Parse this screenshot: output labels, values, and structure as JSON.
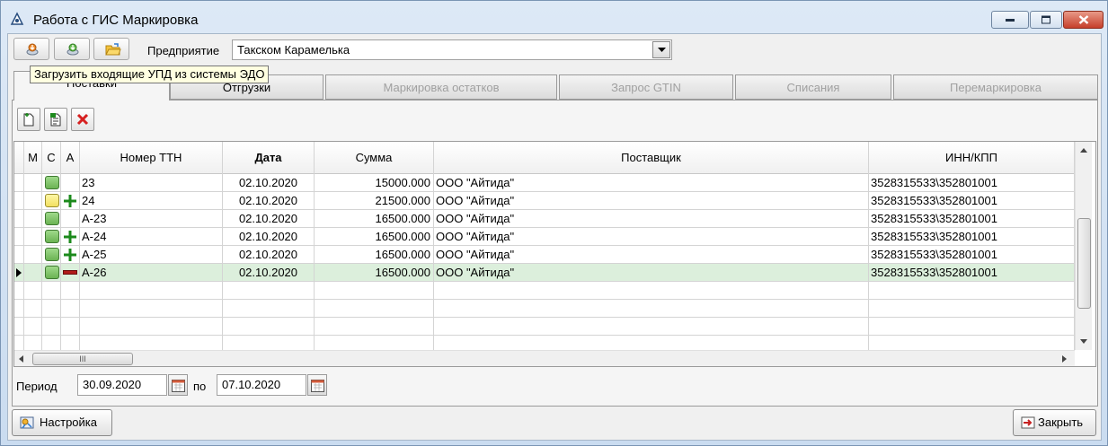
{
  "window": {
    "title": "Работа с ГИС Маркировка"
  },
  "toolbar": {
    "enterprise_label": "Предприятие",
    "enterprise_value": "Такском Карамелька",
    "tooltip": "Загрузить входящие УПД из системы ЭДО"
  },
  "tabs": [
    {
      "label": "Поставки",
      "state": "active"
    },
    {
      "label": "Отгрузки",
      "state": "enabled"
    },
    {
      "label": "Маркировка остатков",
      "state": "disabled"
    },
    {
      "label": "Запрос GTIN",
      "state": "disabled"
    },
    {
      "label": "Списания",
      "state": "disabled"
    },
    {
      "label": "Перемаркировка",
      "state": "disabled"
    }
  ],
  "grid": {
    "columns": [
      "М",
      "С",
      "А",
      "Номер ТТН",
      "Дата",
      "Сумма",
      "Поставщик",
      "ИНН/КПП"
    ],
    "rows": [
      {
        "status": "green",
        "action": "",
        "number": "23",
        "date": "02.10.2020",
        "sum": "15000.000",
        "supplier": "ООО \"Айтида\"",
        "inn": "3528315533\\352801001"
      },
      {
        "status": "yellow",
        "action": "plus",
        "number": "24",
        "date": "02.10.2020",
        "sum": "21500.000",
        "supplier": "ООО \"Айтида\"",
        "inn": "3528315533\\352801001"
      },
      {
        "status": "green",
        "action": "",
        "number": "А-23",
        "date": "02.10.2020",
        "sum": "16500.000",
        "supplier": "ООО \"Айтида\"",
        "inn": "3528315533\\352801001"
      },
      {
        "status": "green",
        "action": "plus",
        "number": "А-24",
        "date": "02.10.2020",
        "sum": "16500.000",
        "supplier": "ООО \"Айтида\"",
        "inn": "3528315533\\352801001"
      },
      {
        "status": "green",
        "action": "plus",
        "number": "А-25",
        "date": "02.10.2020",
        "sum": "16500.000",
        "supplier": "ООО \"Айтида\"",
        "inn": "3528315533\\352801001"
      },
      {
        "status": "green",
        "action": "minus",
        "number": "А-26",
        "date": "02.10.2020",
        "sum": "16500.000",
        "supplier": "ООО \"Айтида\"",
        "inn": "3528315533\\352801001"
      }
    ],
    "selected_row": 5,
    "hscroll_thumb": "III"
  },
  "period": {
    "label": "Период",
    "from": "30.09.2020",
    "to_label": "по",
    "to": "07.10.2020"
  },
  "buttons": {
    "settings": "Настройка",
    "close": "Закрыть"
  },
  "colors": {
    "status_green": "#7cc465",
    "status_yellow": "#f6e874",
    "selected_row": "#dcefdc",
    "delete_red": "#d62020",
    "plus_green": "#1c8a1c"
  }
}
